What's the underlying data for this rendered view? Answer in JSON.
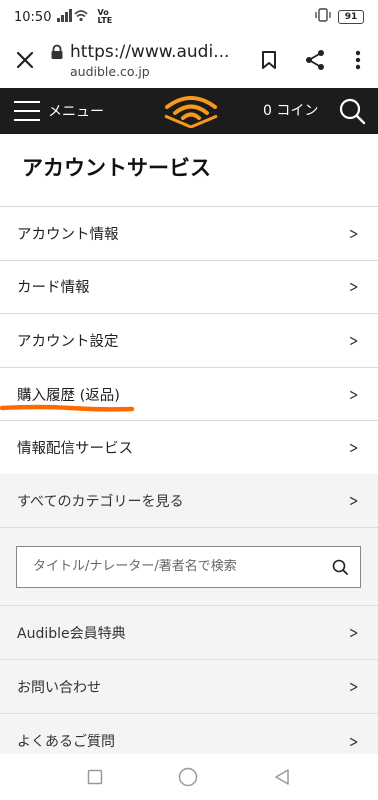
{
  "status_bar": {
    "time": "10:50",
    "network": "Vo LTE",
    "battery": "91"
  },
  "browser": {
    "url": "https://www.audi...",
    "domain": "audible.co.jp"
  },
  "site_header": {
    "menu_label": "メニュー",
    "coins": "0 コイン"
  },
  "page": {
    "title": "アカウントサービス"
  },
  "account_menu": [
    {
      "label": "アカウント情報"
    },
    {
      "label": "カード情報"
    },
    {
      "label": "アカウント設定"
    },
    {
      "label": "購入履歴 (返品)"
    },
    {
      "label": "情報配信サービス"
    }
  ],
  "categories_link": "すべてのカテゴリーを見る",
  "search": {
    "placeholder": "タイトル/ナレーター/著者名で検索"
  },
  "more_links": [
    {
      "label": "Audible会員特典"
    },
    {
      "label": "お問い合わせ"
    },
    {
      "label": "よくあるご質問"
    }
  ],
  "colors": {
    "header_bg": "#1c1c1c",
    "logo_orange": "#f7991c",
    "annotation_orange": "#ff6a00"
  }
}
